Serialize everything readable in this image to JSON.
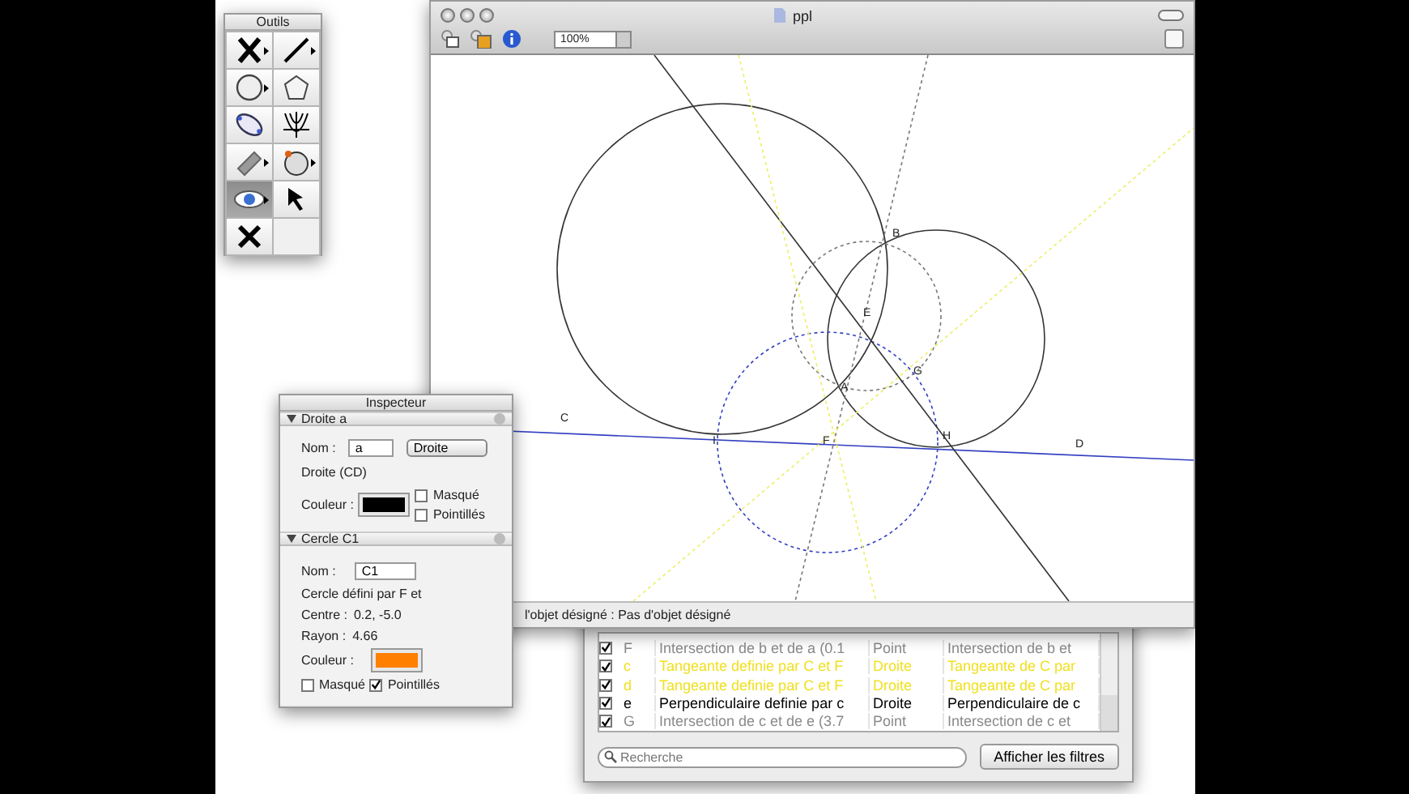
{
  "palette": {
    "title": "Outils",
    "tools": [
      {
        "kind": "point",
        "submenu": true,
        "selected": false
      },
      {
        "kind": "line",
        "submenu": true,
        "selected": false
      },
      {
        "kind": "circle",
        "submenu": true,
        "selected": false
      },
      {
        "kind": "polygon",
        "submenu": false,
        "selected": false
      },
      {
        "kind": "conic",
        "submenu": false,
        "selected": false
      },
      {
        "kind": "parabola",
        "submenu": false,
        "selected": false
      },
      {
        "kind": "ruler",
        "submenu": true,
        "selected": false
      },
      {
        "kind": "compass",
        "submenu": true,
        "selected": false
      },
      {
        "kind": "eye",
        "submenu": true,
        "selected": true
      },
      {
        "kind": "pointer",
        "submenu": false,
        "selected": false
      },
      {
        "kind": "delete",
        "submenu": false,
        "selected": false
      }
    ]
  },
  "document": {
    "title": "ppl",
    "zoom": "100%",
    "points": [
      {
        "label": "B"
      },
      {
        "label": "E"
      },
      {
        "label": "G"
      },
      {
        "label": "A"
      },
      {
        "label": "C"
      },
      {
        "label": "I"
      },
      {
        "label": "F"
      },
      {
        "label": "H"
      },
      {
        "label": "D"
      }
    ],
    "status": "l'objet désigné : Pas d'objet désigné"
  },
  "inspector": {
    "title": "Inspecteur",
    "sections": [
      {
        "kind": "line",
        "title": "Droite a",
        "name_label": "Nom :",
        "name": "a",
        "type": "Droite",
        "description": "Droite (CD)",
        "color_label": "Couleur :",
        "color": "#000000",
        "hidden_label": "Masqué",
        "hidden": false,
        "dotted_label": "Pointillés",
        "dotted": false
      },
      {
        "kind": "circle",
        "title": "Cercle C1",
        "name_label": "Nom :",
        "name": "C1",
        "description": "Cercle défini par F et",
        "facts": [
          {
            "label": "Centre :",
            "value": "0.2, -5.0"
          },
          {
            "label": "Rayon :",
            "value": "4.66"
          }
        ],
        "color_label": "Couleur :",
        "color": "#ff8000",
        "hidden_label": "Masqué",
        "hidden": false,
        "dotted_label": "Pointillés",
        "dotted": true
      }
    ]
  },
  "objects": {
    "rows": [
      {
        "visible": true,
        "name": "F",
        "definition": "Intersection de b et de a (0.1",
        "type": "Point",
        "description": "Intersection de b et",
        "color": "#8a8a8a"
      },
      {
        "visible": true,
        "name": "c",
        "definition": "Tangeante definie par C et F",
        "type": "Droite",
        "description": "Tangeante de C par",
        "color": "#f0e020"
      },
      {
        "visible": true,
        "name": "d",
        "definition": "Tangeante definie par C et F",
        "type": "Droite",
        "description": "Tangeante de C par",
        "color": "#f0e020"
      },
      {
        "visible": true,
        "name": "e",
        "definition": "Perpendiculaire definie par c",
        "type": "Droite",
        "description": "Perpendiculaire de c",
        "color": "#000000"
      },
      {
        "visible": true,
        "name": "G",
        "definition": "Intersection de c et de e (3.7",
        "type": "Point",
        "description": "Intersection de c et",
        "color": "#8a8a8a"
      }
    ],
    "search": {
      "placeholder": "Recherche"
    },
    "filter_button": "Afficher les filtres"
  }
}
